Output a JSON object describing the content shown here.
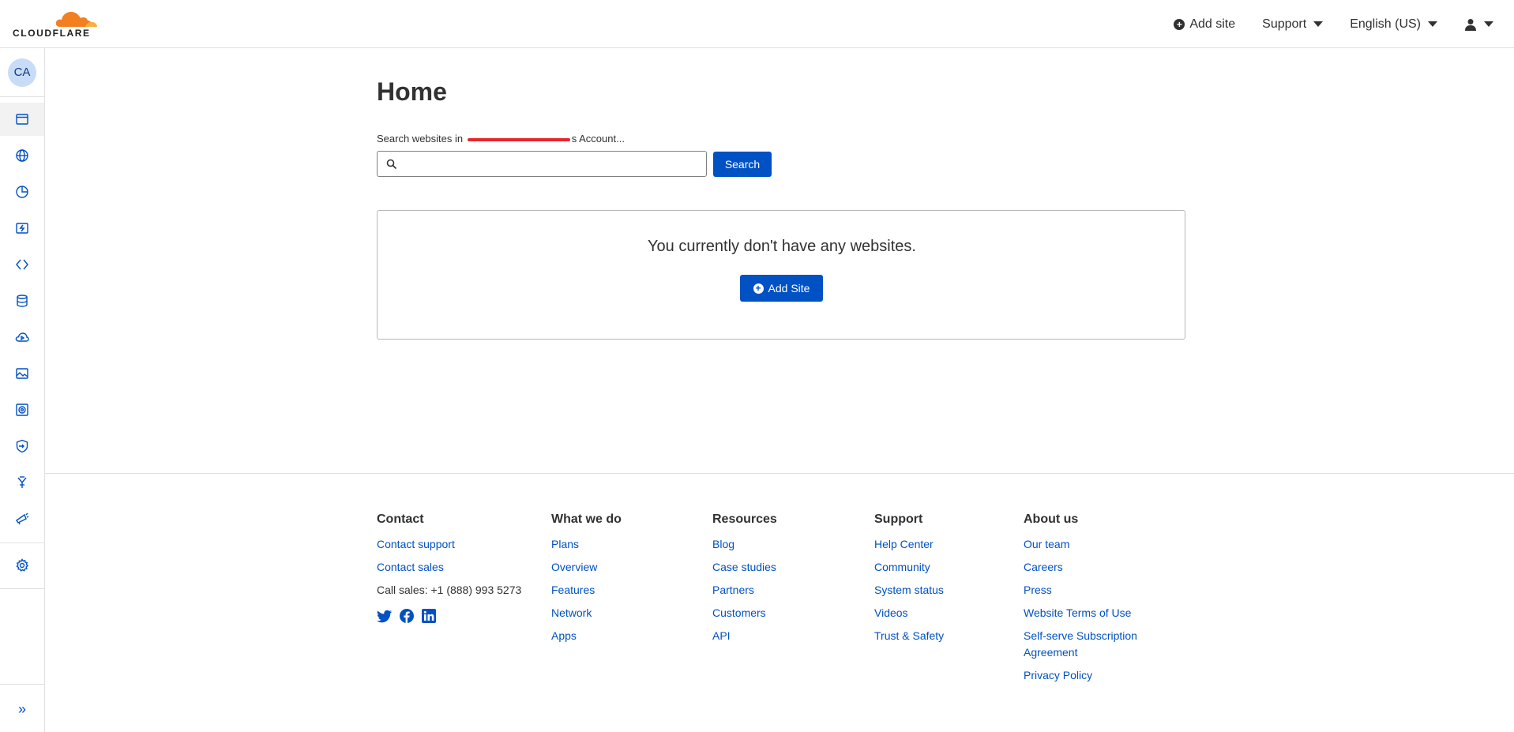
{
  "brand": {
    "logo_text": "CLOUDFLARE",
    "accent": "#f38020",
    "primary": "#0051c3"
  },
  "topbar": {
    "add_site": "Add site",
    "support": "Support",
    "language": "English (US)"
  },
  "sidebar": {
    "avatar": "CA",
    "items": [
      {
        "icon": "websites-icon",
        "active": true
      },
      {
        "icon": "globe-icon"
      },
      {
        "icon": "analytics-icon"
      },
      {
        "icon": "workers-icon"
      },
      {
        "icon": "pages-icon"
      },
      {
        "icon": "storage-icon"
      },
      {
        "icon": "stream-icon"
      },
      {
        "icon": "images-icon"
      },
      {
        "icon": "security-center-icon"
      },
      {
        "icon": "zero-trust-icon"
      },
      {
        "icon": "logs-icon"
      },
      {
        "icon": "notifications-icon"
      },
      {
        "icon": "settings-icon"
      }
    ]
  },
  "main": {
    "title": "Home",
    "search_label_prefix": "Search websites in ",
    "search_label_suffix": "s Account...",
    "search_placeholder": "",
    "search_button": "Search",
    "empty_message": "You currently don't have any websites.",
    "add_site_button": "Add Site"
  },
  "footer": {
    "contact": {
      "heading": "Contact",
      "links": [
        "Contact support",
        "Contact sales"
      ],
      "phone": "Call sales: +1 (888) 993 5273"
    },
    "what_we_do": {
      "heading": "What we do",
      "links": [
        "Plans",
        "Overview",
        "Features",
        "Network",
        "Apps"
      ]
    },
    "resources": {
      "heading": "Resources",
      "links": [
        "Blog",
        "Case studies",
        "Partners",
        "Customers",
        "API"
      ]
    },
    "support": {
      "heading": "Support",
      "links": [
        "Help Center",
        "Community",
        "System status",
        "Videos",
        "Trust & Safety"
      ]
    },
    "about": {
      "heading": "About us",
      "links": [
        "Our team",
        "Careers",
        "Press",
        "Website Terms of Use",
        "Self-serve Subscription Agreement",
        "Privacy Policy"
      ]
    }
  }
}
